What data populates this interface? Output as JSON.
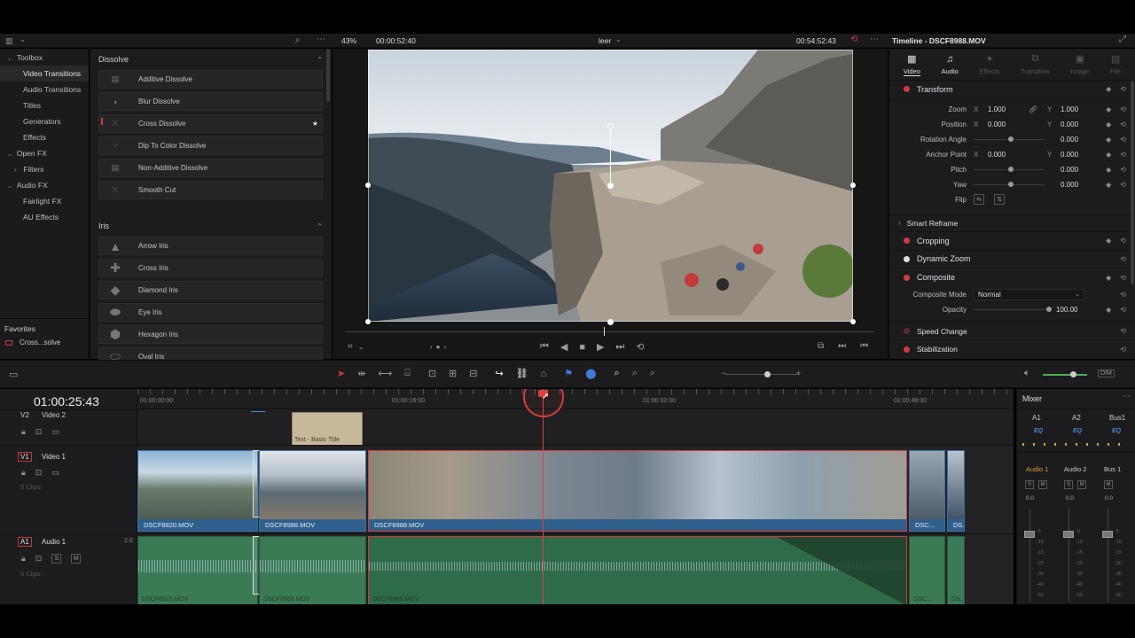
{
  "effects": {
    "toolbox": [
      {
        "label": "Toolbox",
        "type": "cat"
      },
      {
        "label": "Video Transitions",
        "type": "item",
        "selected": true
      },
      {
        "label": "Audio Transitions",
        "type": "item"
      },
      {
        "label": "Titles",
        "type": "item"
      },
      {
        "label": "Generators",
        "type": "item"
      },
      {
        "label": "Effects",
        "type": "item"
      },
      {
        "label": "Open FX",
        "type": "cat"
      },
      {
        "label": "Filters",
        "type": "sub"
      },
      {
        "label": "Audio FX",
        "type": "cat"
      },
      {
        "label": "Fairlight FX",
        "type": "item"
      },
      {
        "label": "AU Effects",
        "type": "item"
      }
    ],
    "favorites_title": "Favorites",
    "favorites": [
      "Cross...solve"
    ],
    "dissolve_title": "Dissolve",
    "dissolve": [
      "Additive Dissolve",
      "Blur Dissolve",
      "Cross Dissolve",
      "Dip To Color Dissolve",
      "Non-Additive Dissolve",
      "Smooth Cut"
    ],
    "iris_title": "Iris",
    "iris": [
      "Arrow Iris",
      "Cross Iris",
      "Diamond Iris",
      "Eye Iris",
      "Hexagon Iris",
      "Oval Iris"
    ]
  },
  "viewer": {
    "zoom": "43%",
    "source_tc": "00:00:52:40",
    "clip_name": "leer",
    "timeline_tc": "00:54:52:43"
  },
  "inspector": {
    "title": "Timeline - DSCF8988.MOV",
    "tabs": [
      "Video",
      "Audio",
      "Effects",
      "Transition",
      "Image",
      "File"
    ],
    "transform": "Transform",
    "zoom_label": "Zoom",
    "zoom_x": "1.000",
    "zoom_y": "1.000",
    "position_label": "Position",
    "position_x": "0.000",
    "position_y": "0.000",
    "rotation_label": "Rotation Angle",
    "rotation": "0.000",
    "anchor_label": "Anchor Point",
    "anchor_x": "0.000",
    "anchor_y": "0.000",
    "pitch_label": "Pitch",
    "pitch": "0.000",
    "yaw_label": "Yaw",
    "yaw": "0.000",
    "flip_label": "Flip",
    "smart_reframe": "Smart Reframe",
    "cropping": "Cropping",
    "dynamic_zoom": "Dynamic Zoom",
    "composite": "Composite",
    "composite_mode_label": "Composite Mode",
    "composite_mode": "Normal",
    "opacity_label": "Opacity",
    "opacity": "100.00",
    "speed_change": "Speed Change",
    "stabilization": "Stabilization",
    "x": "X",
    "y": "Y"
  },
  "timeline": {
    "timecode": "01:00:25:43",
    "ruler": [
      "01:00:00:00",
      "01:00:16:00",
      "01:00:32:00",
      "01:00:48:00"
    ],
    "tracks": {
      "v2": {
        "id": "V2",
        "name": "Video 2"
      },
      "v1": {
        "id": "V1",
        "name": "Video 1",
        "clips": "5 Clips"
      },
      "a1": {
        "id": "A1",
        "name": "Audio 1",
        "level": "2.0",
        "clips": "5 Clips"
      }
    },
    "title_clip": "Text - Basic Title",
    "video_clips": [
      "DSCF8820.MOV",
      "DSCF8988.MOV",
      "DSCF8988.MOV",
      "DSC...",
      "DS..."
    ],
    "audio_clips": [
      "DSCF8820.MOV",
      "DSCF8988.MOV",
      "DSCF8988.MOV",
      "DSC...",
      "DS..."
    ]
  },
  "mixer": {
    "title": "Mixer",
    "top": [
      "A1",
      "A2",
      "Bus1"
    ],
    "eq": "EQ",
    "strips": [
      "Audio 1",
      "Audio 2",
      "Bus 1"
    ],
    "levels": [
      "0.0",
      "0.0",
      "0.0"
    ],
    "scale": [
      "-5",
      "-10",
      "-15",
      "-20",
      "-30",
      "-40",
      "-50"
    ],
    "dim": "DIM"
  },
  "colors": {
    "accent": "#d23b3b",
    "clip_blue": "#2f5f8c",
    "audio_green": "#3f8a5c"
  }
}
